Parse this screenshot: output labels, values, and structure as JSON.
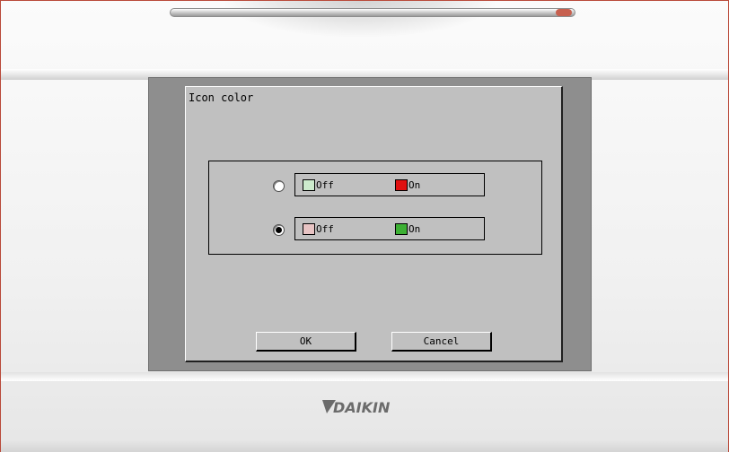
{
  "dialog": {
    "title": "Icon color",
    "options": [
      {
        "selected": false,
        "off_label": "Off",
        "on_label": "On",
        "off_color": "#cdebcd",
        "on_color": "#e01010"
      },
      {
        "selected": true,
        "off_label": "Off",
        "on_label": "On",
        "off_color": "#e8c4c4",
        "on_color": "#3db034"
      }
    ],
    "ok_label": "OK",
    "cancel_label": "Cancel"
  },
  "device": {
    "brand": "DAIKIN",
    "screen_background": "#c0c0c0",
    "brand_color": "#6b6b6b"
  }
}
